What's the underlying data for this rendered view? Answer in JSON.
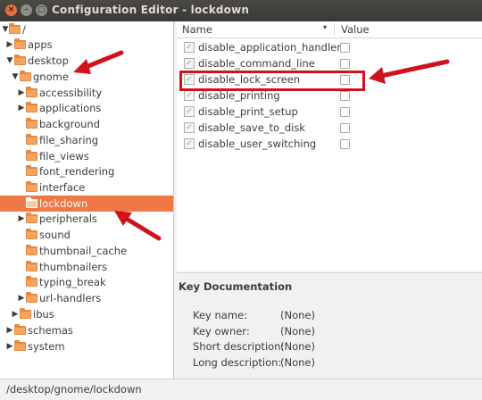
{
  "window": {
    "title": "Configuration Editor - lockdown",
    "close_glyph": "×",
    "min_glyph": "–",
    "max_glyph": "□"
  },
  "tree": {
    "rows": [
      {
        "label": "/",
        "expanded": true
      },
      {
        "label": "apps",
        "expanded": false
      },
      {
        "label": "desktop",
        "expanded": true
      },
      {
        "label": "gnome",
        "expanded": true
      },
      {
        "label": "accessibility",
        "expanded": false
      },
      {
        "label": "applications",
        "expanded": false
      },
      {
        "label": "background"
      },
      {
        "label": "file_sharing"
      },
      {
        "label": "file_views"
      },
      {
        "label": "font_rendering"
      },
      {
        "label": "interface"
      },
      {
        "label": "lockdown",
        "selected": true
      },
      {
        "label": "peripherals",
        "expanded": false
      },
      {
        "label": "sound"
      },
      {
        "label": "thumbnail_cache"
      },
      {
        "label": "thumbnailers"
      },
      {
        "label": "typing_break"
      },
      {
        "label": "url-handlers",
        "expanded": false
      },
      {
        "label": "ibus",
        "expanded": false
      },
      {
        "label": "schemas",
        "expanded": false
      },
      {
        "label": "system",
        "expanded": false
      }
    ]
  },
  "keys": {
    "header_name": "Name",
    "header_value": "Value",
    "sort_glyph": "▾",
    "items": [
      {
        "name": "disable_application_handlers",
        "value": false
      },
      {
        "name": "disable_command_line",
        "value": false
      },
      {
        "name": "disable_lock_screen",
        "value": false
      },
      {
        "name": "disable_printing",
        "value": false
      },
      {
        "name": "disable_print_setup",
        "value": false
      },
      {
        "name": "disable_save_to_disk",
        "value": false
      },
      {
        "name": "disable_user_switching",
        "value": false
      }
    ]
  },
  "doc": {
    "title": "Key Documentation",
    "key_name_label": "Key name:",
    "key_name_value": "(None)",
    "key_owner_label": "Key owner:",
    "key_owner_value": "(None)",
    "short_desc_label": "Short description:",
    "short_desc_value": "(None)",
    "long_desc_label": "Long description:",
    "long_desc_value": "(None)"
  },
  "status": {
    "path": "/desktop/gnome/lockdown"
  },
  "colors": {
    "selection": "#f07746",
    "annotation": "#d0121b",
    "titlebar": "#3c3b37"
  }
}
